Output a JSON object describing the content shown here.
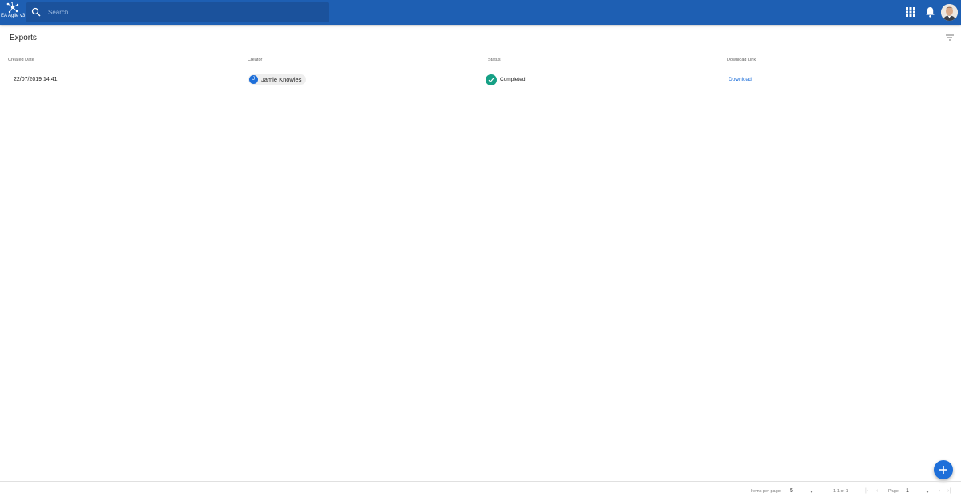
{
  "app": {
    "logo_text": "EA Agile v3",
    "search_placeholder": "Search"
  },
  "header_icons": [
    "apps-icon",
    "bell-icon",
    "user-avatar"
  ],
  "page": {
    "title": "Exports"
  },
  "table": {
    "columns": [
      "Created Date",
      "Creator",
      "Status",
      "Download Link"
    ],
    "rows": [
      {
        "created_date": "22/07/2019 14:41",
        "creator_initial": "J",
        "creator_name": "Jamie Knowles",
        "status": "Completed",
        "download_label": "Download"
      }
    ]
  },
  "paginator": {
    "items_per_page_label": "Items per page:",
    "items_per_page": "5",
    "range_label": "1-1 of 1",
    "page_label": "Page:",
    "page": "1"
  },
  "colors": {
    "app_bar": "#1e5fb3",
    "search_bg": "#1b529c",
    "accent": "#1e6fd9",
    "status_completed": "#16a085"
  }
}
